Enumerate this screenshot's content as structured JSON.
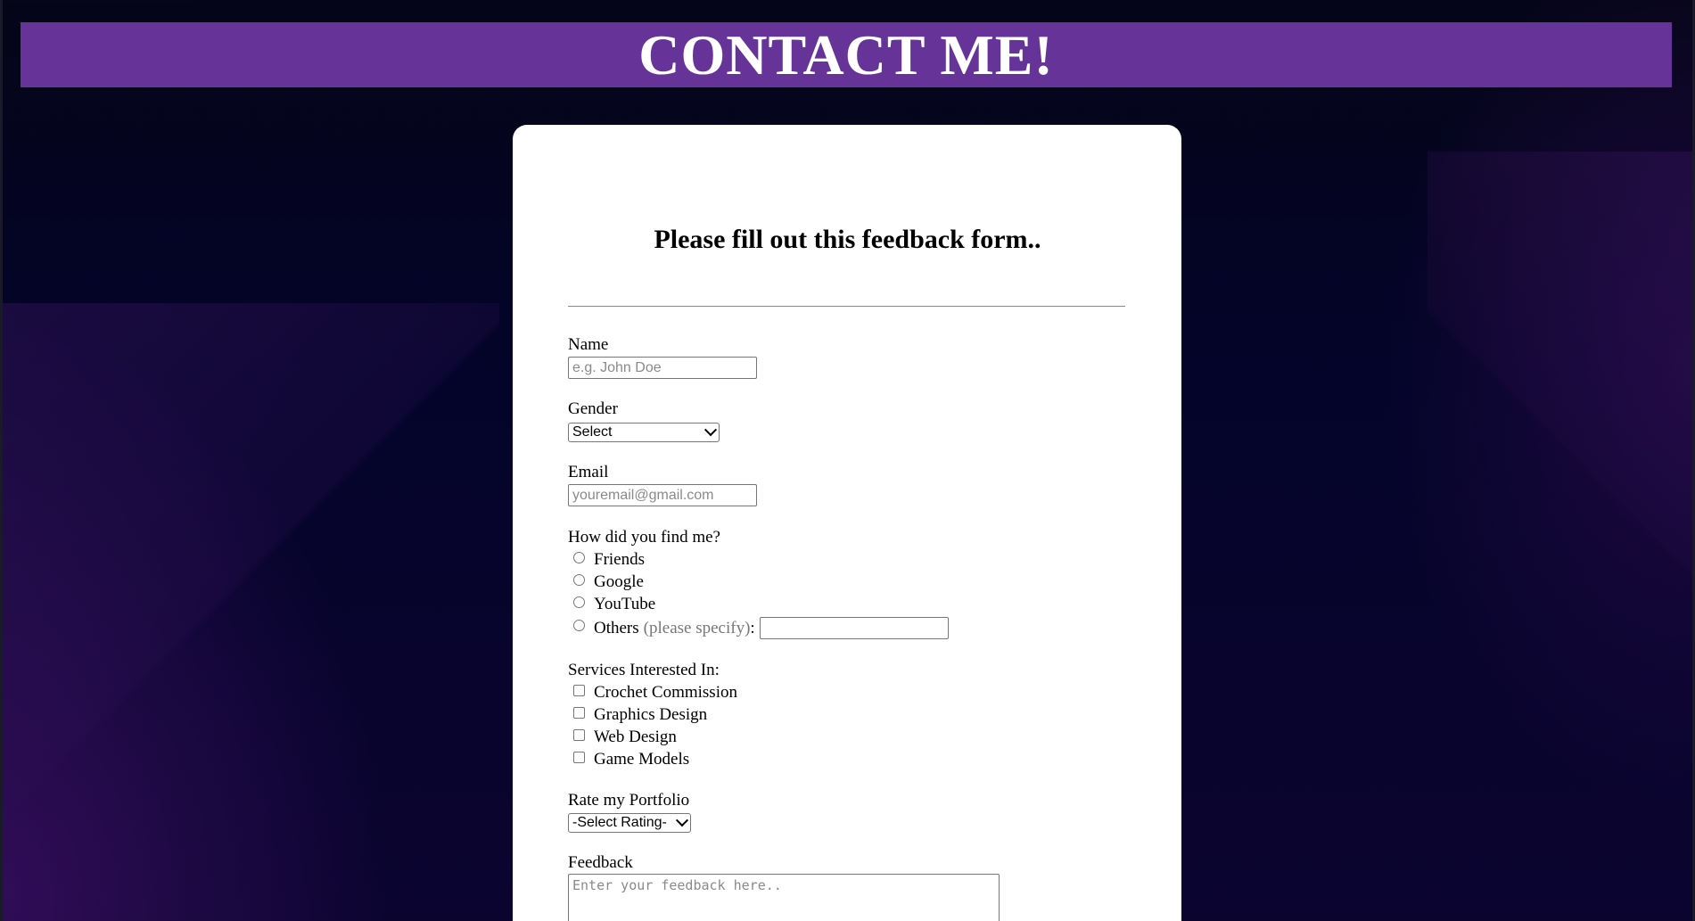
{
  "header": {
    "title": "CONTACT ME!"
  },
  "form": {
    "title": "Please fill out this feedback form..",
    "name": {
      "label": "Name",
      "placeholder": "e.g. John Doe"
    },
    "gender": {
      "label": "Gender",
      "selected": "Select"
    },
    "email": {
      "label": "Email",
      "placeholder": "youremail@gmail.com"
    },
    "find_me": {
      "label": "How did you find me?",
      "options": [
        "Friends",
        "Google",
        "YouTube",
        "Others"
      ],
      "others_hint": "(please specify)",
      "others_colon": ":"
    },
    "services": {
      "label": "Services Interested In:",
      "options": [
        "Crochet Commission",
        "Graphics Design",
        "Web Design",
        "Game Models"
      ]
    },
    "rating": {
      "label": "Rate my Portfolio",
      "selected": "-Select Rating-"
    },
    "feedback": {
      "label": "Feedback",
      "placeholder": "Enter your feedback here.."
    }
  },
  "colors": {
    "header_bg": "#663399",
    "page_bg": "#03031f",
    "card_bg": "#ffffff"
  }
}
